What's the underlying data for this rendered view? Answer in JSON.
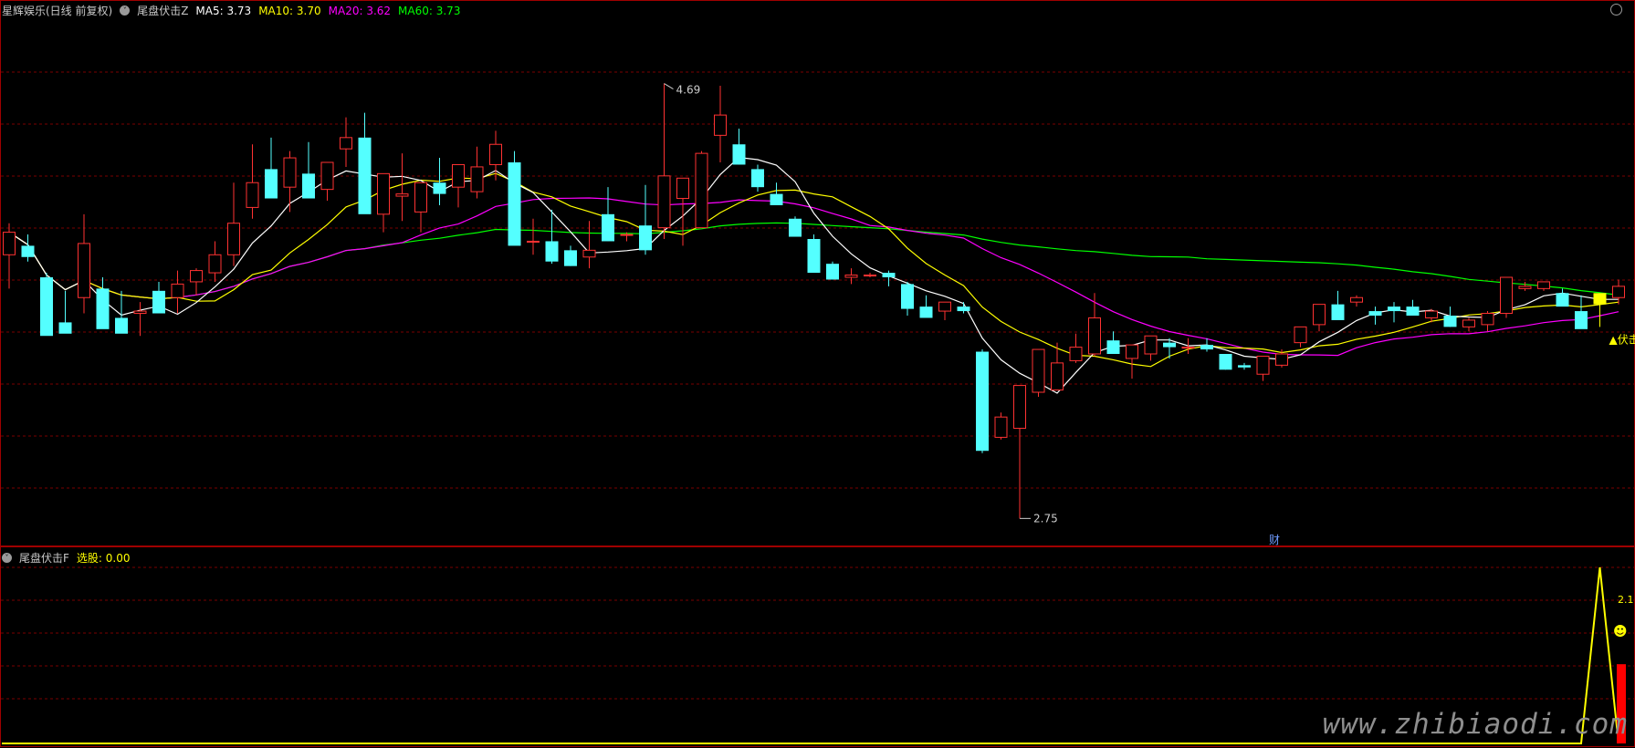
{
  "header": {
    "stock_name": "星辉娱乐(日线 前复权)",
    "indicator": "尾盘伏击Z",
    "ma5_label": "MA5: 3.73",
    "ma10_label": "MA10: 3.70",
    "ma20_label": "MA20: 3.62",
    "ma60_label": "MA60: 3.73"
  },
  "sub_header": {
    "indicator": "尾盘伏击F",
    "select_label": "选股: 0.00"
  },
  "annotations": {
    "high_label": "4.69",
    "low_label": "2.75",
    "signal_label": "▲伏击",
    "cai_label": "财",
    "sub_peak_label": "2.1",
    "smiley": "☻"
  },
  "watermark": "www.zhibiaodi.com",
  "colors": {
    "up": "#ff3232",
    "down": "#54ffff",
    "signal": "#ffff00",
    "ma5": "#ffffff",
    "ma10": "#ffff00",
    "ma20": "#ff00ff",
    "ma60": "#00ff00",
    "grid": "#7a0000",
    "frame": "#a00000"
  },
  "chart_data": [
    {
      "type": "candlestick",
      "ylim": [
        2.63,
        5.01
      ],
      "ohlc": [
        [
          3.92,
          4.06,
          3.77,
          4.02
        ],
        [
          3.96,
          4.01,
          3.89,
          3.91
        ],
        [
          3.82,
          3.84,
          3.57,
          3.56
        ],
        [
          3.62,
          3.76,
          3.58,
          3.57
        ],
        [
          3.73,
          4.1,
          3.66,
          3.97
        ],
        [
          3.77,
          3.82,
          3.62,
          3.59
        ],
        [
          3.64,
          3.76,
          3.58,
          3.57
        ],
        [
          3.66,
          3.71,
          3.56,
          3.67
        ],
        [
          3.76,
          3.8,
          3.66,
          3.66
        ],
        [
          3.73,
          3.85,
          3.66,
          3.79
        ],
        [
          3.8,
          3.86,
          3.74,
          3.85
        ],
        [
          3.84,
          3.98,
          3.8,
          3.92
        ],
        [
          3.92,
          4.24,
          3.87,
          4.06
        ],
        [
          4.13,
          4.41,
          4.08,
          4.24
        ],
        [
          4.3,
          4.44,
          4.17,
          4.17
        ],
        [
          4.22,
          4.38,
          4.11,
          4.35
        ],
        [
          4.28,
          4.42,
          4.19,
          4.17
        ],
        [
          4.21,
          4.29,
          4.16,
          4.33
        ],
        [
          4.39,
          4.53,
          4.31,
          4.44
        ],
        [
          4.44,
          4.55,
          4.23,
          4.1
        ],
        [
          4.1,
          4.2,
          4.02,
          4.28
        ],
        [
          4.18,
          4.37,
          4.07,
          4.19
        ],
        [
          4.11,
          4.22,
          4.02,
          4.24
        ],
        [
          4.24,
          4.35,
          4.14,
          4.19
        ],
        [
          4.22,
          4.32,
          4.13,
          4.32
        ],
        [
          4.2,
          4.4,
          4.17,
          4.31
        ],
        [
          4.32,
          4.47,
          4.25,
          4.41
        ],
        [
          4.33,
          4.38,
          4.12,
          3.96
        ],
        [
          3.98,
          4.08,
          3.92,
          3.98
        ],
        [
          3.98,
          4.12,
          3.88,
          3.89
        ],
        [
          3.94,
          3.96,
          3.87,
          3.87
        ],
        [
          3.91,
          4.07,
          3.86,
          3.94
        ],
        [
          4.1,
          4.22,
          3.98,
          3.98
        ],
        [
          4.01,
          4.02,
          3.98,
          4.01
        ],
        [
          4.05,
          4.23,
          3.92,
          3.94
        ],
        [
          4.04,
          4.68,
          3.99,
          4.27
        ],
        [
          4.17,
          4.25,
          3.96,
          4.26
        ],
        [
          4.04,
          4.38,
          4.08,
          4.37
        ],
        [
          4.45,
          4.67,
          4.33,
          4.54
        ],
        [
          4.41,
          4.48,
          4.32,
          4.32
        ],
        [
          4.3,
          4.32,
          4.2,
          4.22
        ],
        [
          4.19,
          4.24,
          4.16,
          4.14
        ],
        [
          4.08,
          4.09,
          4.01,
          4.0
        ],
        [
          3.99,
          4.01,
          3.85,
          3.84
        ],
        [
          3.88,
          3.89,
          3.81,
          3.81
        ],
        [
          3.82,
          3.86,
          3.79,
          3.83
        ],
        [
          3.83,
          3.84,
          3.82,
          3.83
        ],
        [
          3.84,
          3.85,
          3.78,
          3.82
        ],
        [
          3.79,
          3.8,
          3.65,
          3.68
        ],
        [
          3.69,
          3.74,
          3.67,
          3.64
        ],
        [
          3.67,
          3.69,
          3.63,
          3.71
        ],
        [
          3.69,
          3.71,
          3.66,
          3.67
        ],
        [
          3.49,
          3.5,
          3.04,
          3.05
        ],
        [
          3.11,
          3.22,
          3.1,
          3.2
        ],
        [
          3.15,
          3.34,
          2.75,
          3.34
        ],
        [
          3.31,
          3.48,
          3.29,
          3.5
        ],
        [
          3.32,
          3.53,
          3.33,
          3.44
        ],
        [
          3.45,
          3.57,
          3.44,
          3.51
        ],
        [
          3.48,
          3.75,
          3.47,
          3.64
        ],
        [
          3.54,
          3.58,
          3.53,
          3.48
        ],
        [
          3.46,
          3.5,
          3.37,
          3.52
        ],
        [
          3.48,
          3.54,
          3.45,
          3.56
        ],
        [
          3.53,
          3.55,
          3.46,
          3.51
        ],
        [
          3.51,
          3.55,
          3.48,
          3.51
        ],
        [
          3.52,
          3.55,
          3.49,
          3.5
        ],
        [
          3.48,
          3.47,
          3.41,
          3.41
        ],
        [
          3.43,
          3.44,
          3.41,
          3.42
        ],
        [
          3.39,
          3.46,
          3.36,
          3.47
        ],
        [
          3.43,
          3.5,
          3.42,
          3.48
        ],
        [
          3.53,
          3.59,
          3.51,
          3.6
        ],
        [
          3.61,
          3.7,
          3.58,
          3.7
        ],
        [
          3.7,
          3.76,
          3.69,
          3.63
        ],
        [
          3.71,
          3.74,
          3.69,
          3.73
        ],
        [
          3.67,
          3.69,
          3.61,
          3.65
        ],
        [
          3.69,
          3.71,
          3.62,
          3.67
        ],
        [
          3.69,
          3.72,
          3.67,
          3.65
        ],
        [
          3.64,
          3.68,
          3.62,
          3.67
        ],
        [
          3.65,
          3.69,
          3.6,
          3.6
        ],
        [
          3.6,
          3.64,
          3.58,
          3.63
        ],
        [
          3.61,
          3.67,
          3.58,
          3.66
        ],
        [
          3.66,
          3.76,
          3.64,
          3.82
        ],
        [
          3.77,
          3.8,
          3.76,
          3.78
        ],
        [
          3.77,
          3.78,
          3.76,
          3.8
        ],
        [
          3.75,
          3.77,
          3.74,
          3.69
        ],
        [
          3.67,
          3.74,
          3.6,
          3.59
        ],
        [
          3.7,
          3.71,
          3.6,
          3.75
        ],
        [
          3.73,
          3.81,
          3.7,
          3.78
        ]
      ],
      "signal_index": 85
    },
    {
      "type": "line",
      "name": "选股",
      "values": [
        0,
        0,
        0,
        0,
        0,
        0,
        0,
        0,
        0,
        0,
        0,
        0,
        0,
        0,
        0,
        0,
        0,
        0,
        0,
        0,
        0,
        0,
        0,
        0,
        0,
        0,
        0,
        0,
        0,
        0,
        0,
        0,
        0,
        0,
        0,
        0,
        0,
        0,
        0,
        0,
        0,
        0,
        0,
        0,
        0,
        0,
        0,
        0,
        0,
        0,
        0,
        0,
        0,
        0,
        0,
        0,
        0,
        0,
        0,
        0,
        0,
        0,
        0,
        0,
        0,
        0,
        0,
        0,
        0,
        0,
        0,
        0,
        0,
        0,
        0,
        0,
        0,
        0,
        0,
        0,
        0,
        0,
        0,
        0,
        0,
        1,
        0
      ],
      "bar_value": 0.45,
      "ylim": [
        0,
        1
      ]
    }
  ]
}
